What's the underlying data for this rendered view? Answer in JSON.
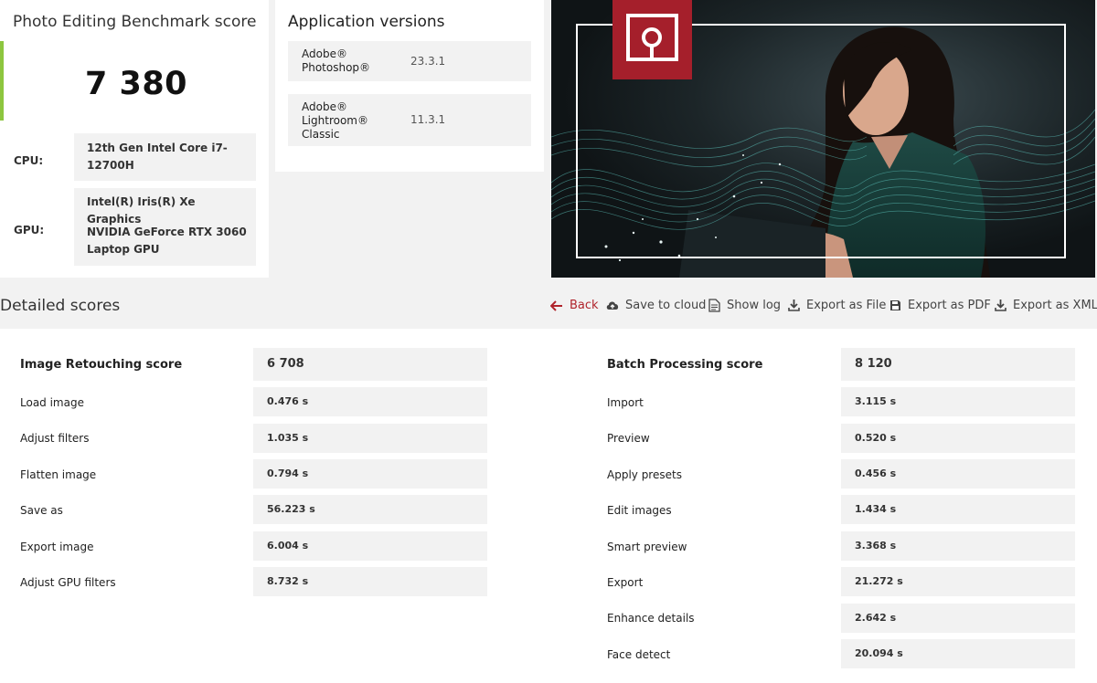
{
  "benchmark": {
    "title": "Photo Editing Benchmark score",
    "score": "7 380",
    "cpu_label": "CPU:",
    "cpu_value": "12th Gen Intel Core i7-12700H",
    "gpu_label": "GPU:",
    "gpu_values": [
      "Intel(R) Iris(R) Xe Graphics",
      "NVIDIA GeForce RTX 3060 Laptop GPU"
    ],
    "accent_color": "#8dc63f"
  },
  "app_versions": {
    "title": "Application versions",
    "apps": [
      {
        "name": "Adobe® Photoshop®",
        "version": "23.3.1"
      },
      {
        "name": "Adobe® Lightroom® Classic",
        "version": "11.3.1"
      }
    ]
  },
  "hero": {
    "logo_color": "#a51f2b",
    "description_icon": "procyon-logo-icon"
  },
  "detailed": {
    "title": "Detailed scores",
    "actions": [
      {
        "label": "Back",
        "icon": "arrow-left-icon"
      },
      {
        "label": "Save to cloud",
        "icon": "cloud-upload-icon"
      },
      {
        "label": "Show log",
        "icon": "document-icon"
      },
      {
        "label": "Export as File",
        "icon": "download-icon"
      },
      {
        "label": "Export as PDF",
        "icon": "save-icon"
      },
      {
        "label": "Export as XML",
        "icon": "download-icon"
      }
    ],
    "retouching": {
      "title": "Image Retouching score",
      "score": "6 708",
      "rows": [
        {
          "label": "Load image",
          "value": "0.476 s"
        },
        {
          "label": "Adjust filters",
          "value": "1.035 s"
        },
        {
          "label": "Flatten image",
          "value": "0.794 s"
        },
        {
          "label": "Save as",
          "value": "56.223 s"
        },
        {
          "label": "Export image",
          "value": "6.004 s"
        },
        {
          "label": "Adjust GPU filters",
          "value": "8.732 s"
        }
      ]
    },
    "batch": {
      "title": "Batch Processing score",
      "score": "8 120",
      "rows": [
        {
          "label": "Import",
          "value": "3.115 s"
        },
        {
          "label": "Preview",
          "value": "0.520 s"
        },
        {
          "label": "Apply presets",
          "value": "0.456 s"
        },
        {
          "label": "Edit images",
          "value": "1.434 s"
        },
        {
          "label": "Smart preview",
          "value": "3.368 s"
        },
        {
          "label": "Export",
          "value": "21.272 s"
        },
        {
          "label": "Enhance details",
          "value": "2.642 s"
        },
        {
          "label": "Face detect",
          "value": "20.094 s"
        }
      ]
    }
  }
}
